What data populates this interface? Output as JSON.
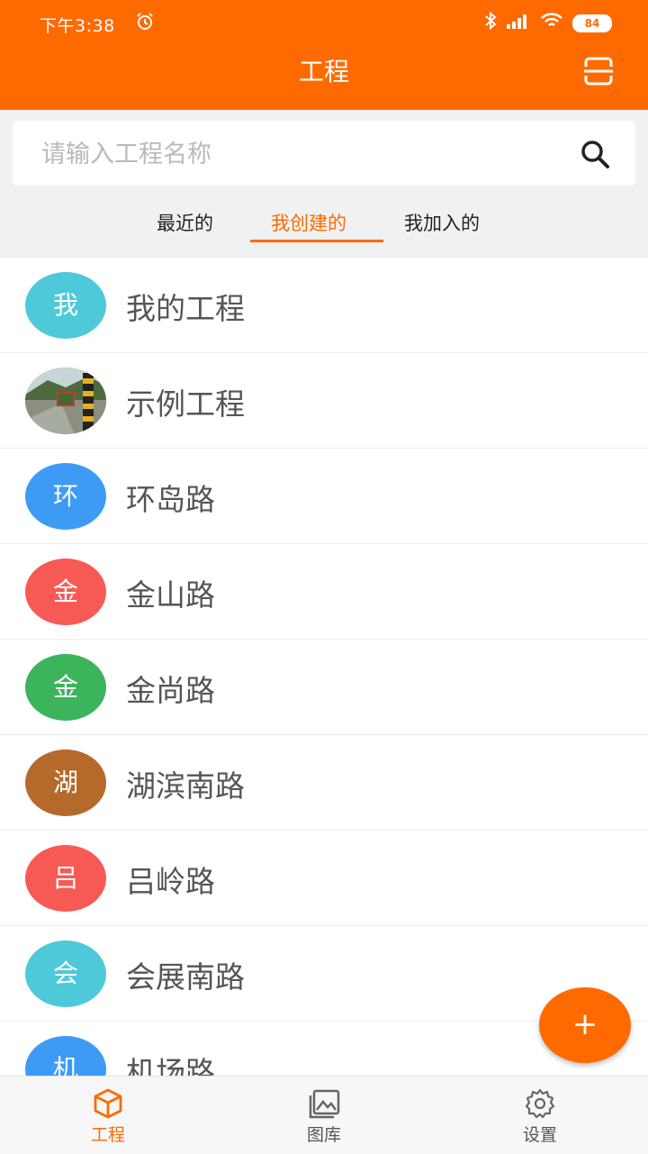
{
  "status_bar": {
    "time": "下午3:38",
    "battery": "84"
  },
  "header": {
    "title": "工程"
  },
  "search": {
    "placeholder": "请输入工程名称"
  },
  "tabs": [
    {
      "label": "最近的",
      "active": false
    },
    {
      "label": "我创建的",
      "active": true
    },
    {
      "label": "我加入的",
      "active": false
    }
  ],
  "projects": [
    {
      "avatar_text": "我",
      "name": "我的工程",
      "color": "#4ec9d9"
    },
    {
      "avatar_text": "",
      "name": "示例工程",
      "color": "#6a7a5c",
      "photo": true
    },
    {
      "avatar_text": "环",
      "name": "环岛路",
      "color": "#3d9bf5"
    },
    {
      "avatar_text": "金",
      "name": "金山路",
      "color": "#f75a55"
    },
    {
      "avatar_text": "金",
      "name": "金尚路",
      "color": "#3cb45c"
    },
    {
      "avatar_text": "湖",
      "name": "湖滨南路",
      "color": "#b56a2c"
    },
    {
      "avatar_text": "吕",
      "name": "吕岭路",
      "color": "#f75a55"
    },
    {
      "avatar_text": "会",
      "name": "会展南路",
      "color": "#4ec9d9"
    },
    {
      "avatar_text": "机",
      "name": "机场路",
      "color": "#3d9bf5"
    }
  ],
  "fab": {
    "label": "+"
  },
  "bottom_nav": [
    {
      "label": "工程",
      "icon": "cube-icon",
      "active": true
    },
    {
      "label": "图库",
      "icon": "gallery-icon",
      "active": false
    },
    {
      "label": "设置",
      "icon": "gear-icon",
      "active": false
    }
  ],
  "colors": {
    "accent": "#ff6a00"
  }
}
